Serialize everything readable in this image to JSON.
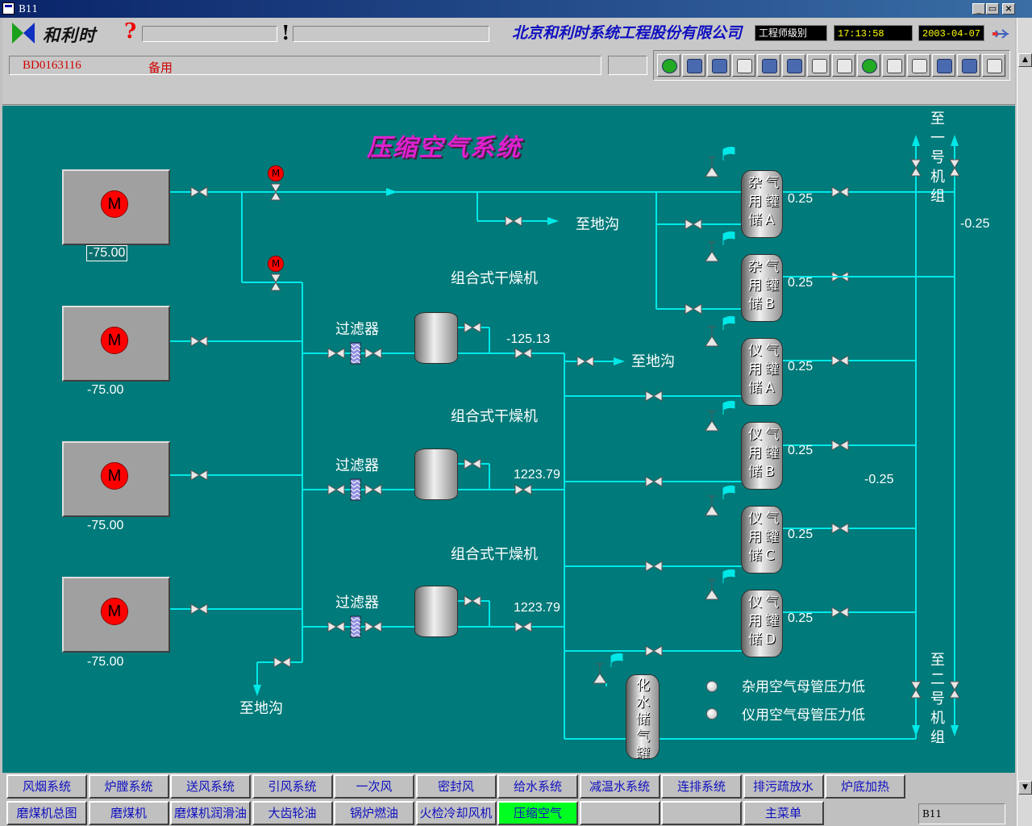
{
  "window": {
    "title": "B11"
  },
  "header": {
    "logo_text": "和利时",
    "company": "北京和利时系统工程股份有限公司",
    "user_level": "工程师级别",
    "time": "17:13:58",
    "date": "2003-04-07",
    "point_id": "BD0163116",
    "point_desc": "备用"
  },
  "page": {
    "title": "压缩空气系统"
  },
  "motors": [
    {
      "symbol": "M",
      "value": "-75.00"
    },
    {
      "symbol": "M",
      "value": "-75.00"
    },
    {
      "symbol": "M",
      "value": "-75.00"
    },
    {
      "symbol": "M",
      "value": "-75.00"
    }
  ],
  "motor_valve_symbol": "M",
  "dryers": [
    {
      "label": "组合式干燥机",
      "filter": "过滤器",
      "value": "-125.13"
    },
    {
      "label": "组合式干燥机",
      "filter": "过滤器",
      "value": "1223.79"
    },
    {
      "label": "组合式干燥机",
      "filter": "过滤器",
      "value": "1223.79"
    }
  ],
  "drain_label": "至地沟",
  "tanks": [
    {
      "chars": [
        "杂",
        "气",
        "用",
        "罐",
        "储",
        "A"
      ],
      "value": "0.25"
    },
    {
      "chars": [
        "杂",
        "气",
        "用",
        "罐",
        "储",
        "B"
      ],
      "value": "0.25"
    },
    {
      "chars": [
        "仪",
        "气",
        "用",
        "罐",
        "储",
        "A"
      ],
      "value": "0.25"
    },
    {
      "chars": [
        "仪",
        "气",
        "用",
        "罐",
        "储",
        "B"
      ],
      "value": "0.25"
    },
    {
      "chars": [
        "仪",
        "气",
        "用",
        "罐",
        "储",
        "C"
      ],
      "value": "0.25"
    },
    {
      "chars": [
        "仪",
        "气",
        "用",
        "罐",
        "储",
        "D"
      ],
      "value": "0.25"
    }
  ],
  "water_tank": {
    "label": [
      "化",
      "水",
      "储",
      "气",
      "罐"
    ]
  },
  "unit1_label": [
    "至",
    "一",
    "号",
    "机",
    "组"
  ],
  "unit2_label": [
    "至",
    "二",
    "号",
    "机",
    "组"
  ],
  "header_values": {
    "top": "-0.25",
    "mid": "-0.25"
  },
  "alarms": [
    "杂用空气母管压力低",
    "仪用空气母管压力低"
  ],
  "nav_row1": [
    "风烟系统",
    "炉膛系统",
    "送风系统",
    "引风系统",
    "一次风",
    "密封风",
    "给水系统",
    "减温水系统",
    "连排系统",
    "排污疏放水",
    "炉底加热"
  ],
  "nav_row2": [
    "磨煤机总图",
    "磨煤机",
    "磨煤机润滑油",
    "大齿轮油",
    "锅炉燃油",
    "火检冷却风机",
    "压缩空气",
    "",
    "",
    "主菜单"
  ],
  "status_field": "B11",
  "colors": {
    "background": "#007a7a",
    "pipe": "#00e8e8",
    "active_nav": "#00ff20",
    "title": "#e020d0"
  }
}
